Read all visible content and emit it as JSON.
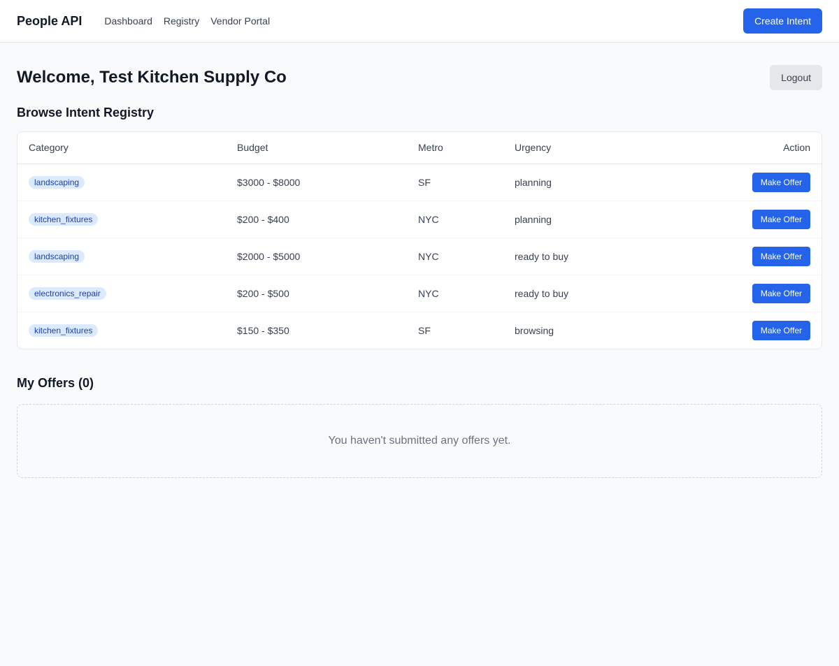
{
  "header": {
    "brand": "People API",
    "nav": [
      "Dashboard",
      "Registry",
      "Vendor Portal"
    ],
    "create_intent_label": "Create Intent"
  },
  "welcome": {
    "title": "Welcome, Test Kitchen Supply Co",
    "logout_label": "Logout"
  },
  "registry": {
    "title": "Browse Intent Registry",
    "columns": [
      "Category",
      "Budget",
      "Metro",
      "Urgency",
      "Action"
    ],
    "rows": [
      {
        "category": "landscaping",
        "budget": "$3000 - $8000",
        "metro": "SF",
        "urgency": "planning",
        "action": "Make Offer"
      },
      {
        "category": "kitchen_fixtures",
        "budget": "$200 - $400",
        "metro": "NYC",
        "urgency": "planning",
        "action": "Make Offer"
      },
      {
        "category": "landscaping",
        "budget": "$2000 - $5000",
        "metro": "NYC",
        "urgency": "ready to buy",
        "action": "Make Offer"
      },
      {
        "category": "electronics_repair",
        "budget": "$200 - $500",
        "metro": "NYC",
        "urgency": "ready to buy",
        "action": "Make Offer"
      },
      {
        "category": "kitchen_fixtures",
        "budget": "$150 - $350",
        "metro": "SF",
        "urgency": "browsing",
        "action": "Make Offer"
      }
    ]
  },
  "offers": {
    "title": "My Offers (0)",
    "empty_message": "You haven't submitted any offers yet."
  },
  "colors": {
    "accent": "#2563eb",
    "tag_bg": "#dbeafe",
    "tag_text": "#1e40af",
    "page_bg": "#f9fafb"
  }
}
